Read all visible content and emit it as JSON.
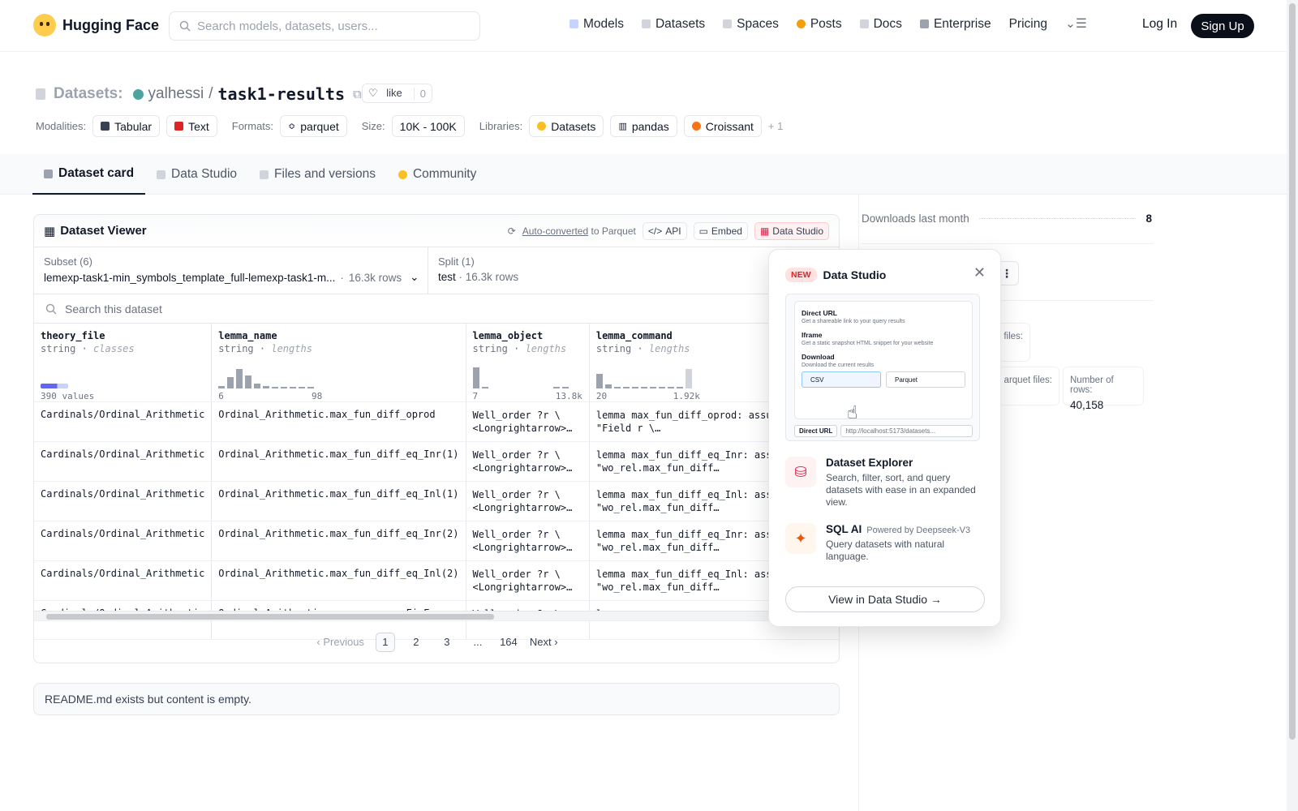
{
  "header": {
    "brand": "Hugging Face",
    "search_placeholder": "Search models, datasets, users...",
    "nav": [
      "Models",
      "Datasets",
      "Spaces",
      "Posts",
      "Docs",
      "Enterprise",
      "Pricing"
    ],
    "login": "Log In",
    "signup": "Sign Up"
  },
  "repo": {
    "label": "Datasets:",
    "user": "yalhessi",
    "sep": "/",
    "name": "task1-results",
    "like": "like",
    "likes": "0"
  },
  "meta": {
    "modalities_label": "Modalities:",
    "modalities": [
      "Tabular",
      "Text"
    ],
    "formats_label": "Formats:",
    "format": "parquet",
    "size_label": "Size:",
    "size": "10K - 100K",
    "libraries_label": "Libraries:",
    "libraries": [
      "Datasets",
      "pandas",
      "Croissant"
    ],
    "more": "+ 1"
  },
  "tabs": [
    "Dataset card",
    "Data Studio",
    "Files and versions",
    "Community"
  ],
  "viewer": {
    "title": "Dataset Viewer",
    "auto_converted": "Auto-converted",
    "to_parquet": "to Parquet",
    "api": "API",
    "embed": "Embed",
    "data_studio": "Data Studio",
    "subset_label": "Subset (6)",
    "subset_value": "lemexp-task1-min_symbols_template_full-lemexp-task1-m...",
    "subset_rows": "16.3k rows",
    "split_label": "Split (1)",
    "split_value": "test",
    "split_rows": "16.3k rows",
    "search_placeholder": "Search this dataset",
    "columns": [
      {
        "name": "theory_file",
        "type": "string",
        "kind": "classes",
        "range_min": "390 values",
        "range_max": ""
      },
      {
        "name": "lemma_name",
        "type": "string",
        "kind": "lengths",
        "range_min": "6",
        "range_max": "98"
      },
      {
        "name": "lemma_object",
        "type": "string",
        "kind": "lengths",
        "range_min": "7",
        "range_max": "13.8k"
      },
      {
        "name": "lemma_command",
        "type": "string",
        "kind": "lengths",
        "range_min": "20",
        "range_max": "1.92k"
      }
    ],
    "rows": [
      [
        "Cardinals/Ordinal_Arithmetic",
        "Ordinal_Arithmetic.max_fun_diff_oprod",
        "Well_order ?r \\ <Longrightarrow>…",
        "lemma max_fun_diff_oprod: assumes Field: \"Field r \\…"
      ],
      [
        "Cardinals/Ordinal_Arithmetic",
        "Ordinal_Arithmetic.max_fun_diff_eq_Inr(1)",
        "Well_order ?r \\ <Longrightarrow>…",
        "lemma max_fun_diff_eq_Inr: assumes \"wo_rel.max_fun_diff…"
      ],
      [
        "Cardinals/Ordinal_Arithmetic",
        "Ordinal_Arithmetic.max_fun_diff_eq_Inl(1)",
        "Well_order ?r \\ <Longrightarrow>…",
        "lemma max_fun_diff_eq_Inl: assumes \"wo_rel.max_fun_diff…"
      ],
      [
        "Cardinals/Ordinal_Arithmetic",
        "Ordinal_Arithmetic.max_fun_diff_eq_Inr(2)",
        "Well_order ?r \\ <Longrightarrow>…",
        "lemma max_fun_diff_eq_Inr: assumes \"wo_rel.max_fun_diff…"
      ],
      [
        "Cardinals/Ordinal_Arithmetic",
        "Ordinal_Arithmetic.max_fun_diff_eq_Inl(2)",
        "Well_order ?r \\ <Longrightarrow>…",
        "lemma max_fun_diff_eq_Inl: assumes \"wo_rel.max_fun_diff…"
      ],
      [
        "Cardinals/Ordinal_Arithmetic",
        "Ordinal_Arithmetic.rev_curr_app_FinFunc",
        "Well_order ?r \\",
        "lemma"
      ]
    ],
    "pager": {
      "prev": "Previous",
      "pages": [
        "1",
        "2",
        "3",
        "...",
        "164"
      ],
      "next": "Next"
    }
  },
  "readme": "README.md exists but content is empty.",
  "sidebar": {
    "downloads_label": "Downloads last month",
    "downloads": "8",
    "files_label": "files:",
    "parquet_label": "arquet files:",
    "rows_label": "Number of rows:",
    "rows_value": "40,158"
  },
  "popup": {
    "badge": "NEW",
    "title": "Data Studio",
    "preview": {
      "direct_url": "Direct URL",
      "direct_url_desc": "Get a shareable link to your query results",
      "iframe": "Iframe",
      "iframe_desc": "Get a static snapshot HTML snippet for your website",
      "download": "Download",
      "download_desc": "Download the current results",
      "csv": "CSV",
      "parquet": "Parquet",
      "bar_label": "Direct URL",
      "bar_url": "http://localhost:5173/datasets..."
    },
    "explorer_title": "Dataset Explorer",
    "explorer_desc": "Search, filter, sort, and query datasets with ease in an expanded view.",
    "sql_title": "SQL AI",
    "sql_powered": "Powered by Deepseek-V3",
    "sql_desc": "Query datasets with natural language.",
    "view_button": "View in Data Studio →"
  }
}
